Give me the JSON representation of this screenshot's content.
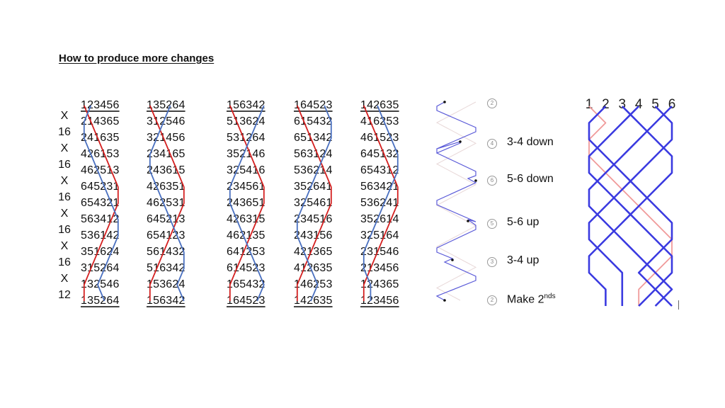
{
  "title": "How to produce more changes",
  "multipliers": [
    "X",
    "16",
    "X",
    "16",
    "X",
    "16",
    "X",
    "16",
    "X",
    "16",
    "X",
    "12"
  ],
  "columns": [
    {
      "rows": [
        "123456",
        "214365",
        "241635",
        "426153",
        "462513",
        "645231",
        "654321",
        "563412",
        "536142",
        "351624",
        "315264",
        "132546",
        "135264"
      ]
    },
    {
      "rows": [
        "135264",
        "312546",
        "321456",
        "234165",
        "243615",
        "426351",
        "462531",
        "645213",
        "654123",
        "561432",
        "516342",
        "153624",
        "156342"
      ]
    },
    {
      "rows": [
        "156342",
        "513624",
        "531264",
        "352146",
        "325416",
        "234561",
        "243651",
        "426315",
        "462135",
        "641253",
        "614523",
        "165432",
        "164523"
      ]
    },
    {
      "rows": [
        "164523",
        "615432",
        "651342",
        "563124",
        "536214",
        "352641",
        "325461",
        "234516",
        "243156",
        "421365",
        "412635",
        "146253",
        "142635"
      ]
    },
    {
      "rows": [
        "142635",
        "416253",
        "461523",
        "645132",
        "654312",
        "563421",
        "536241",
        "352614",
        "325164",
        "231546",
        "213456",
        "124365",
        "123456"
      ]
    }
  ],
  "traced_bells": {
    "red": "1",
    "blue": "2"
  },
  "steps": [
    {
      "circle": "2",
      "label": ""
    },
    {
      "circle": "4",
      "label": "3-4 down"
    },
    {
      "circle": "6",
      "label": "5-6 down"
    },
    {
      "circle": "5",
      "label": "5-6 up"
    },
    {
      "circle": "3",
      "label": "3-4 up"
    },
    {
      "circle": "2",
      "label": "Make 2",
      "sup": "nds"
    }
  ],
  "grid_header": [
    "1",
    "2",
    "3",
    "4",
    "5",
    "6"
  ],
  "colors": {
    "red_line": "#d42020",
    "blue_line": "#4a70c0",
    "zigzag": "#5a5ad8",
    "grid_blue": "#3a3ae0",
    "grid_red": "#f09a9a"
  }
}
